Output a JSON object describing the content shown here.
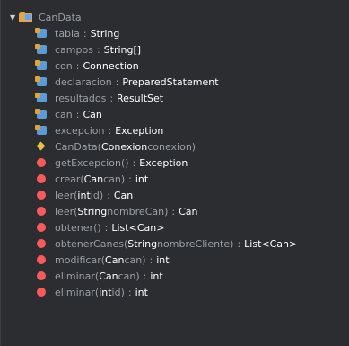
{
  "root": {
    "label": "CanData"
  },
  "fields": [
    {
      "name": "tabla",
      "type": "String"
    },
    {
      "name": "campos",
      "type": "String[]"
    },
    {
      "name": "con",
      "type": "Connection"
    },
    {
      "name": "declaracion",
      "type": "PreparedStatement"
    },
    {
      "name": "resultados",
      "type": "ResultSet"
    },
    {
      "name": "can",
      "type": "Can"
    },
    {
      "name": "excepcion",
      "type": "Exception"
    }
  ],
  "ctor": {
    "name": "CanData",
    "paramType": "Conexion",
    "paramName": "conexion"
  },
  "methods": [
    {
      "name": "getExcepcion",
      "params": [],
      "return": "Exception"
    },
    {
      "name": "crear",
      "params": [
        {
          "type": "Can",
          "name": "can"
        }
      ],
      "return": "int"
    },
    {
      "name": "leer",
      "params": [
        {
          "type": "int",
          "name": "id"
        }
      ],
      "return": "Can"
    },
    {
      "name": "leer",
      "params": [
        {
          "type": "String",
          "name": "nombreCan"
        }
      ],
      "return": "Can"
    },
    {
      "name": "obtener",
      "params": [],
      "return": "List<Can>"
    },
    {
      "name": "obtenerCanes",
      "params": [
        {
          "type": "String",
          "name": "nombreCliente"
        }
      ],
      "return": "List<Can>"
    },
    {
      "name": "modificar",
      "params": [
        {
          "type": "Can",
          "name": "can"
        }
      ],
      "return": "int"
    },
    {
      "name": "eliminar",
      "params": [
        {
          "type": "Can",
          "name": "can"
        }
      ],
      "return": "int"
    },
    {
      "name": "eliminar",
      "params": [
        {
          "type": "int",
          "name": "id"
        }
      ],
      "return": "int"
    }
  ]
}
